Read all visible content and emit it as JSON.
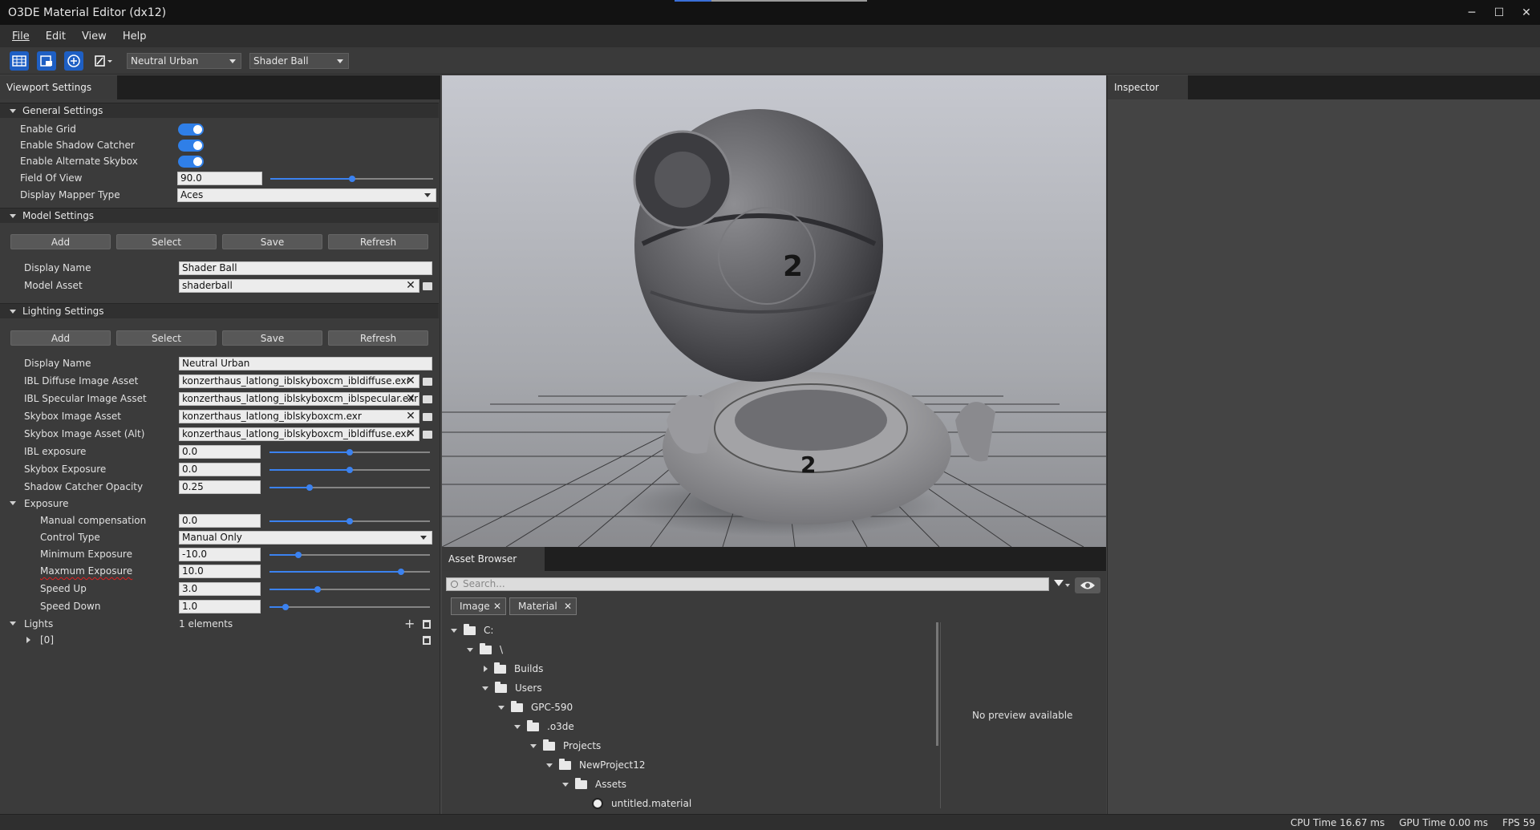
{
  "window": {
    "title": "O3DE Material Editor (dx12)",
    "minimize": "─",
    "maximize": "☐",
    "close": "✕"
  },
  "menu": [
    "File",
    "Edit",
    "View",
    "Help"
  ],
  "toolbar": {
    "lighting_preset": "Neutral Urban",
    "model_preset": "Shader Ball"
  },
  "viewport_settings": {
    "tab": "Viewport Settings",
    "general": {
      "header": "General Settings",
      "enable_grid": "Enable Grid",
      "enable_shadow_catcher": "Enable Shadow Catcher",
      "enable_alt_skybox": "Enable Alternate Skybox",
      "fov_label": "Field Of View",
      "fov_value": "90.0",
      "fov_level": 0.5,
      "mapper_label": "Display Mapper Type",
      "mapper_value": "Aces"
    },
    "model": {
      "header": "Model Settings",
      "add": "Add",
      "select": "Select",
      "save": "Save",
      "refresh": "Refresh",
      "display_name_label": "Display Name",
      "display_name": "Shader Ball",
      "asset_label": "Model Asset",
      "asset": "shaderball"
    },
    "lighting": {
      "header": "Lighting Settings",
      "add": "Add",
      "select": "Select",
      "save": "Save",
      "refresh": "Refresh",
      "display_name_label": "Display Name",
      "display_name": "Neutral Urban",
      "ibl_diffuse_label": "IBL Diffuse Image Asset",
      "ibl_diffuse": "konzerthaus_latlong_iblskyboxcm_ibldiffuse.exr",
      "ibl_specular_label": "IBL Specular Image Asset",
      "ibl_specular": "konzerthaus_latlong_iblskyboxcm_iblspecular.exr",
      "skybox_label": "Skybox Image Asset",
      "skybox": "konzerthaus_latlong_iblskyboxcm.exr",
      "skybox_alt_label": "Skybox Image Asset (Alt)",
      "skybox_alt": "konzerthaus_latlong_iblskyboxcm_ibldiffuse.exr",
      "ibl_exposure_label": "IBL exposure",
      "ibl_exposure": "0.0",
      "ibl_exposure_level": 0.5,
      "skybox_exposure_label": "Skybox Exposure",
      "skybox_exposure": "0.0",
      "skybox_exposure_level": 0.5,
      "shadow_opacity_label": "Shadow Catcher Opacity",
      "shadow_opacity": "0.25",
      "shadow_opacity_level": 0.25
    },
    "exposure": {
      "header": "Exposure",
      "manual_comp_label": "Manual compensation",
      "manual_comp": "0.0",
      "manual_comp_level": 0.5,
      "control_type_label": "Control Type",
      "control_type": "Manual Only",
      "min_label": "Minimum Exposure",
      "min": "-10.0",
      "min_level": 0.18,
      "max_label": "Maxmum Exposure",
      "max": "10.0",
      "max_level": 0.82,
      "speed_up_label": "Speed Up",
      "speed_up": "3.0",
      "speed_up_level": 0.3,
      "speed_down_label": "Speed Down",
      "speed_down": "1.0",
      "speed_down_level": 0.1
    },
    "lights": {
      "header": "Lights",
      "count": "1 elements",
      "item": "[0]"
    }
  },
  "viewport": {
    "ball_number_top": "2",
    "ball_number_base": "2"
  },
  "asset_browser": {
    "tab": "Asset Browser",
    "search_placeholder": "Search...",
    "chips": [
      "Image",
      "Material"
    ],
    "no_preview": "No preview available",
    "tree": [
      "C:",
      "\\",
      "Builds",
      "Users",
      "GPC-590",
      ".o3de",
      "Projects",
      "NewProject12",
      "Assets",
      "untitled.material"
    ]
  },
  "inspector": {
    "tab": "Inspector"
  },
  "status": {
    "cpu": "CPU Time 16.67 ms",
    "gpu": "GPU Time 0.00 ms",
    "fps": "FPS 59"
  },
  "colors": {
    "accent": "#3b82f0",
    "underline": "#e02020"
  }
}
